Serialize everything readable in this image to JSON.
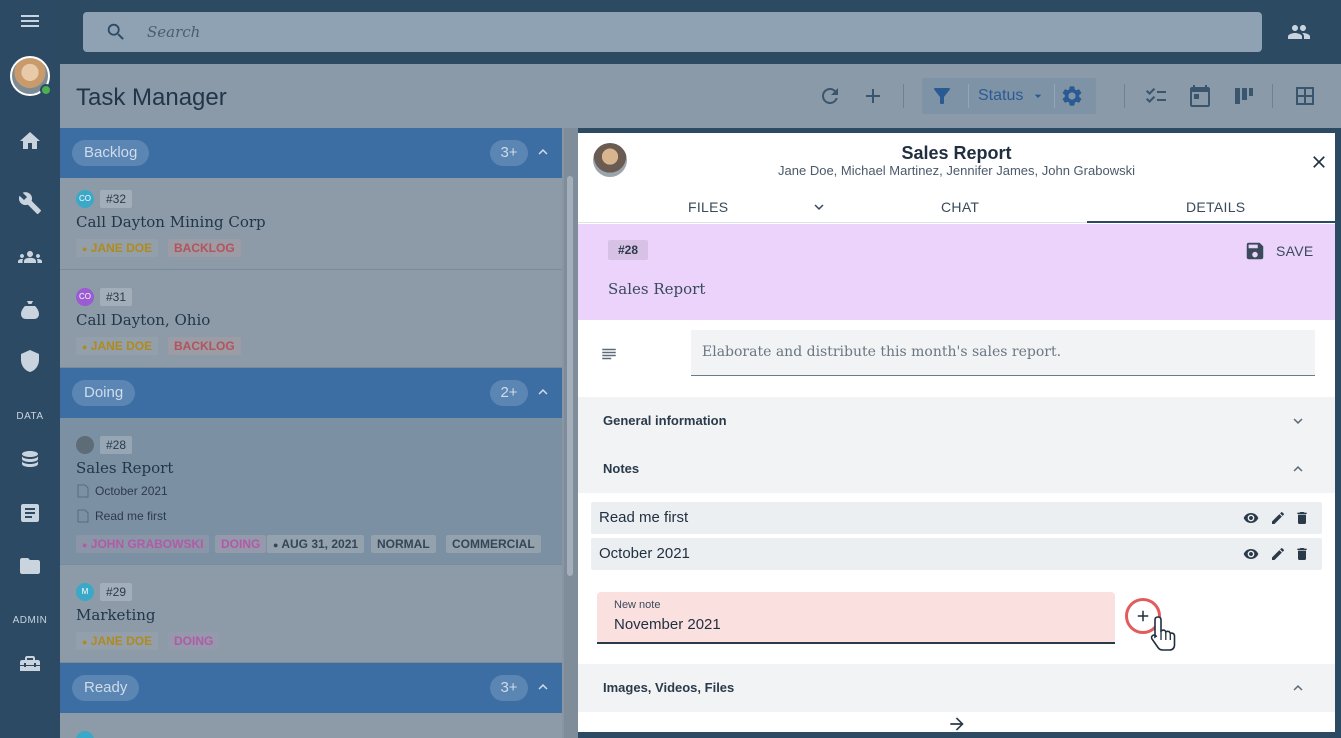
{
  "app": {
    "title": "Task Manager",
    "search_placeholder": "Search"
  },
  "rail": {
    "sections": {
      "data": "DATA",
      "admin": "ADMIN"
    }
  },
  "header": {
    "status_label": "Status"
  },
  "groups": [
    {
      "label": "Backlog",
      "count": "3+"
    },
    {
      "label": "Doing",
      "count": "2+"
    },
    {
      "label": "Ready",
      "count": "3+"
    }
  ],
  "cards": [
    {
      "initials": "CO",
      "number": "#32",
      "title": "Call Dayton Mining Corp",
      "person": "JANE DOE",
      "status": "BACKLOG"
    },
    {
      "initials": "CO",
      "number": "#31",
      "title": "Call Dayton, Ohio",
      "person": "JANE DOE",
      "status": "BACKLOG"
    },
    {
      "number": "#28",
      "title": "Sales Report",
      "docs": [
        "October 2021",
        "Read me first"
      ],
      "person": "JOHN GRABOWSKI",
      "status": "DOING",
      "date": "AUG 31, 2021",
      "priority": "NORMAL",
      "category": "COMMERCIAL"
    },
    {
      "initials": "M",
      "number": "#29",
      "title": "Marketing",
      "person": "JANE DOE",
      "status": "DOING"
    }
  ],
  "panel": {
    "title": "Sales Report",
    "people": "Jane Doe, Michael Martinez, Jennifer James, John Grabowski",
    "tabs": [
      "FILES",
      "CHAT",
      "DETAILS"
    ],
    "active_tab": "DETAILS",
    "task_number": "#28",
    "task_name": "Sales Report",
    "save_label": "SAVE",
    "description": "Elaborate and distribute this month's sales report.",
    "sections": {
      "general": "General information",
      "notes": "Notes",
      "media": "Images, Videos, Files"
    },
    "notes": [
      "Read me first",
      "October 2021"
    ],
    "new_note": {
      "label": "New note",
      "value": "November 2021"
    }
  },
  "colors": {
    "accent": "#3d6ea3",
    "hero_bg": "#ecd3fb",
    "new_note_bg": "#fbe0e0",
    "add_ring": "#e25c5c"
  }
}
